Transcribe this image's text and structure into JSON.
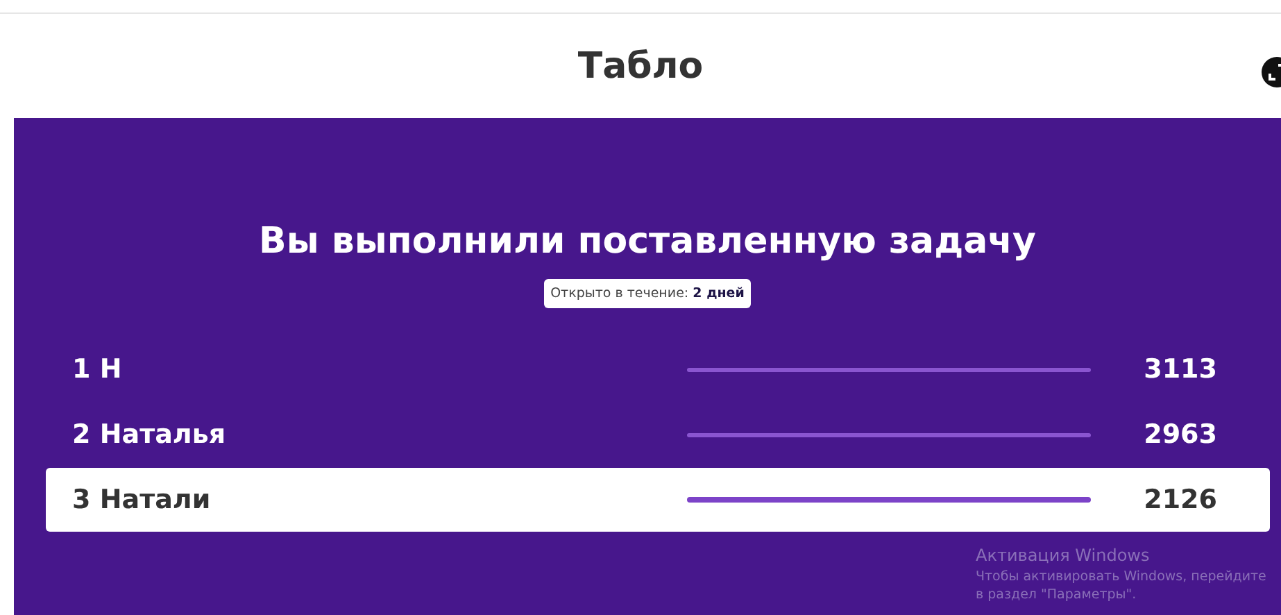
{
  "header": {
    "title": "Табло"
  },
  "board": {
    "heading": "Вы выполнили поставленную задачу",
    "open_label": "Открыто в течение:",
    "open_value": "2 дней",
    "rows": [
      {
        "rank": "1",
        "name": "Н",
        "score": "3113",
        "selected": false
      },
      {
        "rank": "2",
        "name": "Наталья",
        "score": "2963",
        "selected": false
      },
      {
        "rank": "3",
        "name": "Натали",
        "score": "2126",
        "selected": true
      }
    ]
  },
  "os_notice": {
    "title": "Активация Windows",
    "text": "Чтобы активировать Windows, перейдите в раздел \"Параметры\"."
  }
}
